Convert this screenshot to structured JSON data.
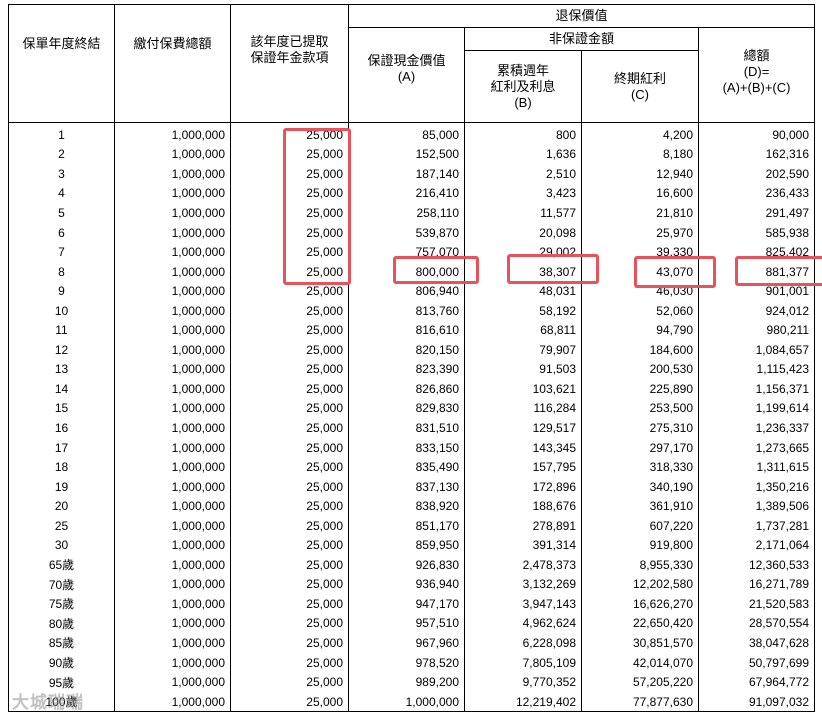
{
  "headers": {
    "col1": "保單年度終結",
    "col2": "繳付保費總額",
    "col3_line1": "該年度已提取",
    "col3_line2": "保證年金款項",
    "group_title": "退保價值",
    "sub_group_title": "非保證金額",
    "col4_line1": "保證現金價值",
    "col4_line2": "(A)",
    "col5_line1": "累積週年",
    "col5_line2": "紅利及利息",
    "col5_line3": "(B)",
    "col6_line1": "終期紅利",
    "col6_line2": "(C)",
    "col7_line1": "總額",
    "col7_line2": "(D)=",
    "col7_line3": "(A)+(B)+(C)"
  },
  "rows": [
    [
      "1",
      "1,000,000",
      "25,000",
      "85,000",
      "800",
      "4,200",
      "90,000"
    ],
    [
      "2",
      "1,000,000",
      "25,000",
      "152,500",
      "1,636",
      "8,180",
      "162,316"
    ],
    [
      "3",
      "1,000,000",
      "25,000",
      "187,140",
      "2,510",
      "12,940",
      "202,590"
    ],
    [
      "4",
      "1,000,000",
      "25,000",
      "216,410",
      "3,423",
      "16,600",
      "236,433"
    ],
    [
      "5",
      "1,000,000",
      "25,000",
      "258,110",
      "11,577",
      "21,810",
      "291,497"
    ],
    [
      "6",
      "1,000,000",
      "25,000",
      "539,870",
      "20,098",
      "25,970",
      "585,938"
    ],
    [
      "7",
      "1,000,000",
      "25,000",
      "757,070",
      "29,002",
      "39,330",
      "825,402"
    ],
    [
      "8",
      "1,000,000",
      "25,000",
      "800,000",
      "38,307",
      "43,070",
      "881,377"
    ],
    [
      "9",
      "1,000,000",
      "25,000",
      "806,940",
      "48,031",
      "46,030",
      "901,001"
    ],
    [
      "10",
      "1,000,000",
      "25,000",
      "813,760",
      "58,192",
      "52,060",
      "924,012"
    ],
    [
      "11",
      "1,000,000",
      "25,000",
      "816,610",
      "68,811",
      "94,790",
      "980,211"
    ],
    [
      "12",
      "1,000,000",
      "25,000",
      "820,150",
      "79,907",
      "184,600",
      "1,084,657"
    ],
    [
      "13",
      "1,000,000",
      "25,000",
      "823,390",
      "91,503",
      "200,530",
      "1,115,423"
    ],
    [
      "14",
      "1,000,000",
      "25,000",
      "826,860",
      "103,621",
      "225,890",
      "1,156,371"
    ],
    [
      "15",
      "1,000,000",
      "25,000",
      "829,830",
      "116,284",
      "253,500",
      "1,199,614"
    ],
    [
      "16",
      "1,000,000",
      "25,000",
      "831,510",
      "129,517",
      "275,310",
      "1,236,337"
    ],
    [
      "17",
      "1,000,000",
      "25,000",
      "833,150",
      "143,345",
      "297,170",
      "1,273,665"
    ],
    [
      "18",
      "1,000,000",
      "25,000",
      "835,490",
      "157,795",
      "318,330",
      "1,311,615"
    ],
    [
      "19",
      "1,000,000",
      "25,000",
      "837,130",
      "172,896",
      "340,190",
      "1,350,216"
    ],
    [
      "20",
      "1,000,000",
      "25,000",
      "838,920",
      "188,676",
      "361,910",
      "1,389,506"
    ],
    [
      "25",
      "1,000,000",
      "25,000",
      "851,170",
      "278,891",
      "607,220",
      "1,737,281"
    ],
    [
      "30",
      "1,000,000",
      "25,000",
      "859,950",
      "391,314",
      "919,800",
      "2,171,064"
    ],
    [
      "65歲",
      "1,000,000",
      "25,000",
      "926,830",
      "2,478,373",
      "8,955,330",
      "12,360,533"
    ],
    [
      "70歲",
      "1,000,000",
      "25,000",
      "936,940",
      "3,132,269",
      "12,202,580",
      "16,271,789"
    ],
    [
      "75歲",
      "1,000,000",
      "25,000",
      "947,170",
      "3,947,143",
      "16,626,270",
      "21,520,583"
    ],
    [
      "80歲",
      "1,000,000",
      "25,000",
      "957,510",
      "4,962,624",
      "22,650,420",
      "28,570,554"
    ],
    [
      "85歲",
      "1,000,000",
      "25,000",
      "967,960",
      "6,228,098",
      "30,851,570",
      "38,047,628"
    ],
    [
      "90歲",
      "1,000,000",
      "25,000",
      "978,520",
      "7,805,109",
      "42,014,070",
      "50,797,699"
    ],
    [
      "95歲",
      "1,000,000",
      "25,000",
      "989,200",
      "9,770,352",
      "57,205,220",
      "67,964,772"
    ],
    [
      "100歲",
      "1,000,000",
      "25,000",
      "1,000,000",
      "12,219,402",
      "77,877,630",
      "91,097,032"
    ]
  ],
  "watermark": "大城瑞瑞",
  "highlight_color": "#e8525a"
}
